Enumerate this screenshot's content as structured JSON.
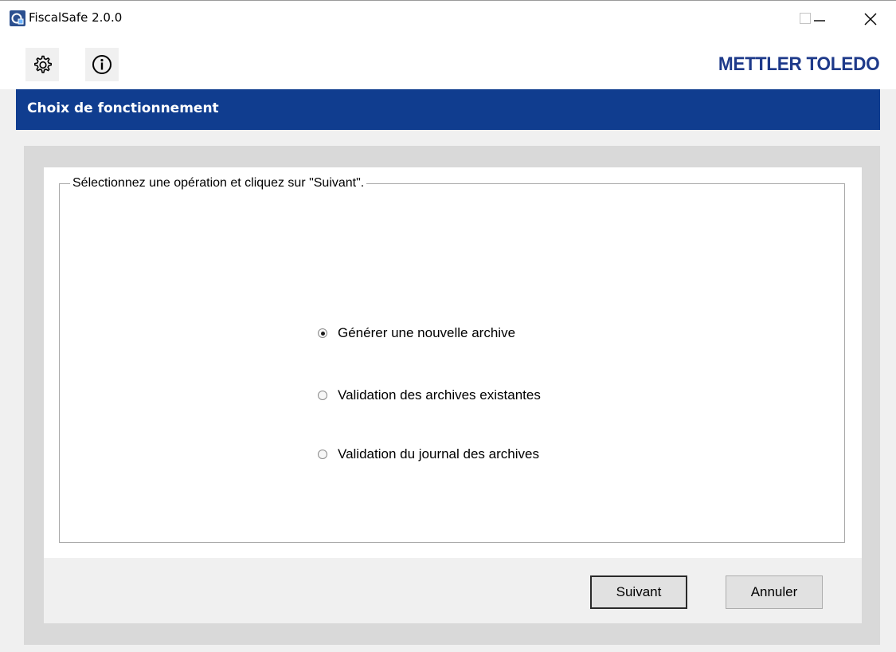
{
  "window": {
    "title": "FiscalSafe 2.0.0",
    "controls": [
      "minimize-icon",
      "maximize-icon",
      "close-icon"
    ]
  },
  "toolbar": {
    "settings_icon": "gear-icon",
    "info_icon": "info-icon",
    "brand": "METTLER TOLEDO"
  },
  "header": {
    "title": "Choix de fonctionnement"
  },
  "group": {
    "legend": "Sélectionnez une opération et cliquez sur \"Suivant\".",
    "options": [
      {
        "label": "Générer une nouvelle archive",
        "selected": true
      },
      {
        "label": "Validation des archives existantes",
        "selected": false
      },
      {
        "label": "Validation du journal des archives",
        "selected": false
      }
    ]
  },
  "buttons": {
    "next": "Suivant",
    "cancel": "Annuler"
  },
  "colors": {
    "header": "#103d8f",
    "brand": "#1e3a8a",
    "outer_panel": "#d9d9d9"
  }
}
